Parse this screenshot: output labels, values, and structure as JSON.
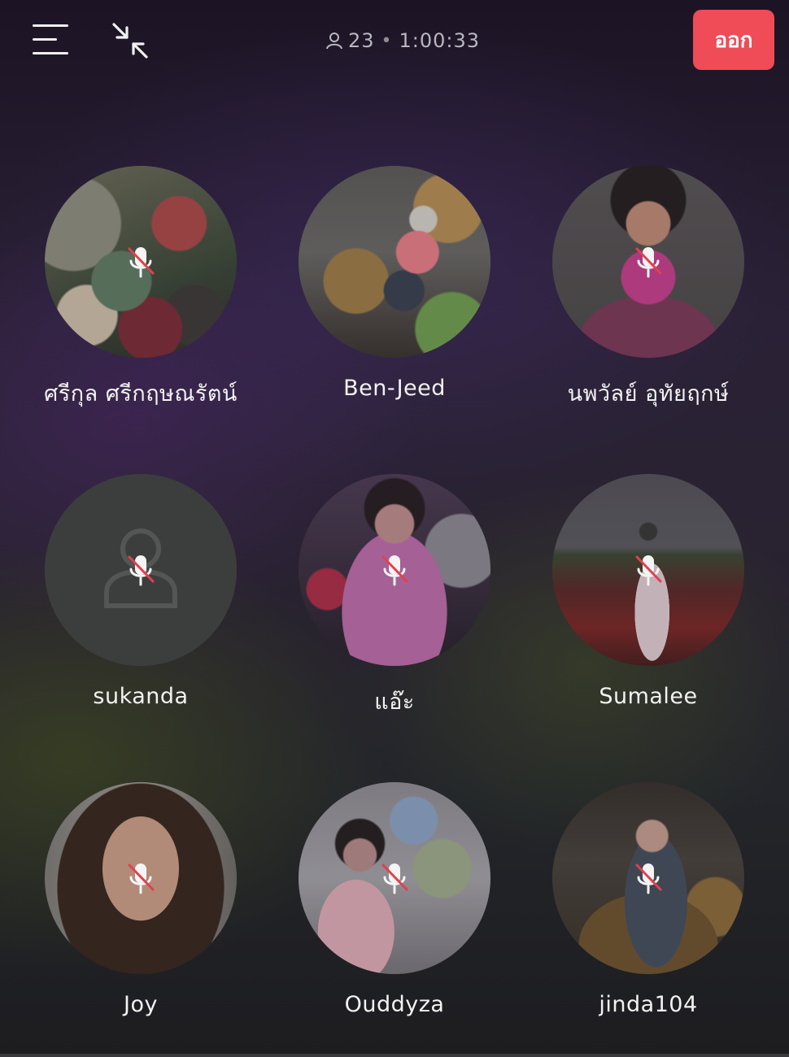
{
  "header": {
    "menu_icon": "menu-icon",
    "minimize_icon": "minimize-arrows-icon",
    "participant_icon": "person-icon",
    "participant_count": "23",
    "separator": "•",
    "elapsed_time": "1:00:33",
    "leave_label": "ออก"
  },
  "colors": {
    "leave_button": "#ef4c57",
    "text": "#f2f2f2",
    "status_text": "#b9b6bf",
    "mute_slash": "#e0414f"
  },
  "participants": [
    {
      "name": "ศรีกุล ศรีกฤษณรัตน์",
      "muted": true,
      "avatar": "group-photo"
    },
    {
      "name": "Ben-Jeed",
      "muted": false,
      "avatar": "photo"
    },
    {
      "name": "นพวัลย์ อุทัยฤกษ์",
      "muted": true,
      "avatar": "photo"
    },
    {
      "name": "sukanda",
      "muted": true,
      "avatar": "default-person-icon"
    },
    {
      "name": "แอ๊ะ",
      "muted": true,
      "avatar": "photo"
    },
    {
      "name": "Sumalee",
      "muted": true,
      "avatar": "photo"
    },
    {
      "name": "Joy",
      "muted": true,
      "avatar": "photo"
    },
    {
      "name": "Ouddyza",
      "muted": true,
      "avatar": "photo"
    },
    {
      "name": "jinda104",
      "muted": true,
      "avatar": "photo"
    }
  ]
}
